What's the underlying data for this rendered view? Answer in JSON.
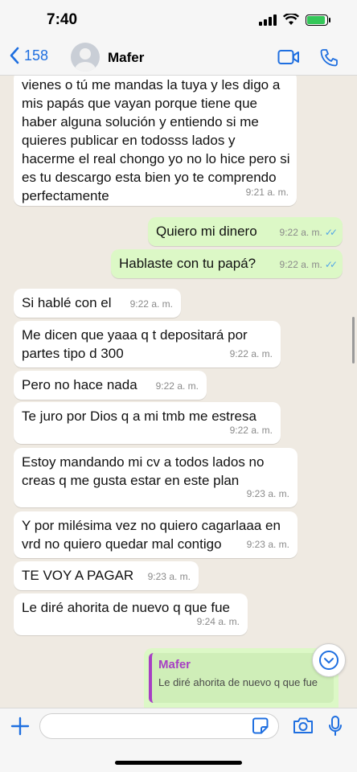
{
  "status_bar": {
    "time": "7:40",
    "battery_level": 0.9
  },
  "header": {
    "back_count": "158",
    "contact_name": "Mafer"
  },
  "messages": [
    {
      "dir": "in",
      "text": "vienes o tú me mandas la tuya y les digo a mis papás que vayan porque tiene que haber alguna solución y entiendo si me quieres publicar en todosss lados y hacerme el real chongo yo no lo hice pero si es tu descargo esta bien yo te comprendo perfectamente",
      "time": "9:21 a. m."
    },
    {
      "dir": "out",
      "text": "Quiero mi dinero",
      "time": "9:22 a. m."
    },
    {
      "dir": "out",
      "text": "Hablaste con tu papá?",
      "time": "9:22 a. m."
    },
    {
      "dir": "in",
      "text": "Si hablé con el",
      "time": "9:22 a. m."
    },
    {
      "dir": "in",
      "text": "Me dicen que yaaa q t depositará por partes tipo d 300",
      "time": "9:22 a. m."
    },
    {
      "dir": "in",
      "text": "Pero no hace nada",
      "time": "9:22 a. m."
    },
    {
      "dir": "in",
      "text": "Te juro por Dios q a mi tmb me estresa",
      "time": "9:22 a. m."
    },
    {
      "dir": "in",
      "text": "Estoy mandando mi cv a todos lados no creas q me gusta estar en este plan",
      "time": "9:23 a. m."
    },
    {
      "dir": "in",
      "text": "Y por milésima vez no quiero cagarlaaa en vrd no quiero quedar mal contigo",
      "time": "9:23 a. m."
    },
    {
      "dir": "in",
      "text": "TE VOY A PAGAR",
      "time": "9:23 a. m."
    },
    {
      "dir": "in",
      "text": "Le diré ahorita de nuevo q que fue",
      "time": "9:24 a. m."
    }
  ],
  "reply": {
    "author": "Mafer",
    "text": "Le diré ahorita de nuevo q que fue"
  },
  "input": {
    "placeholder": ""
  },
  "colors": {
    "outgoing": "#dcf8c6",
    "incoming": "#ffffff",
    "accent": "#1f6fe0",
    "reply_author": "#a73fc4",
    "read_ticks": "#53a6e7"
  },
  "icons": [
    "back-chevron-icon",
    "video-call-icon",
    "phone-icon",
    "plus-icon",
    "sticker-icon",
    "camera-icon",
    "mic-icon",
    "chevron-down-icon"
  ]
}
